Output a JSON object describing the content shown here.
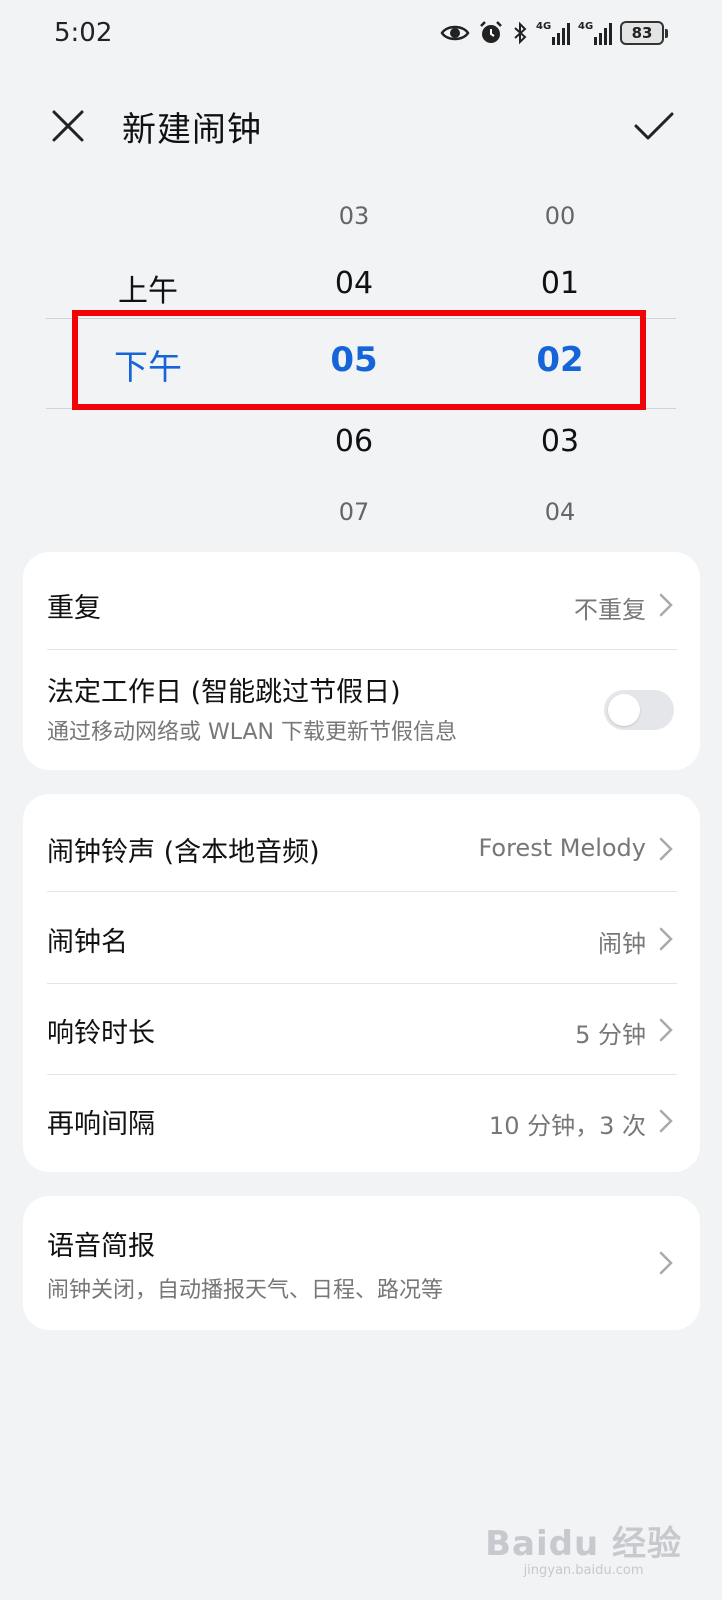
{
  "status_bar": {
    "time": "5:02",
    "network_1": "4G",
    "network_2": "4G",
    "battery": "83"
  },
  "header": {
    "title": "新建闹钟",
    "close_icon": "close-icon",
    "confirm_icon": "check-icon"
  },
  "picker": {
    "ampm": [
      "上午",
      "下午"
    ],
    "selected_ampm": "下午",
    "hours": [
      "03",
      "04",
      "05",
      "06",
      "07"
    ],
    "selected_hour": "05",
    "minutes": [
      "00",
      "01",
      "02",
      "03",
      "04"
    ],
    "selected_minute": "02",
    "highlight_color": "#f00408",
    "selected_color": "#1565d8"
  },
  "card1": {
    "repeat": {
      "label": "重复",
      "value": "不重复"
    },
    "workday": {
      "label": "法定工作日 (智能跳过节假日)",
      "sub": "通过移动网络或 WLAN 下载更新节假信息",
      "enabled": false
    }
  },
  "card2": {
    "ringtone": {
      "label": "闹钟铃声 (含本地音频)",
      "value": "Forest Melody"
    },
    "name": {
      "label": "闹钟名",
      "value": "闹钟"
    },
    "duration": {
      "label": "响铃时长",
      "value": "5 分钟"
    },
    "snooze": {
      "label": "再响间隔",
      "value": "10 分钟，3 次"
    }
  },
  "card3": {
    "briefing": {
      "label": "语音简报",
      "sub": "闹钟关闭，自动播报天气、日程、路况等"
    }
  },
  "watermark": {
    "logo": "Baidu 经验",
    "url": "jingyan.baidu.com"
  }
}
